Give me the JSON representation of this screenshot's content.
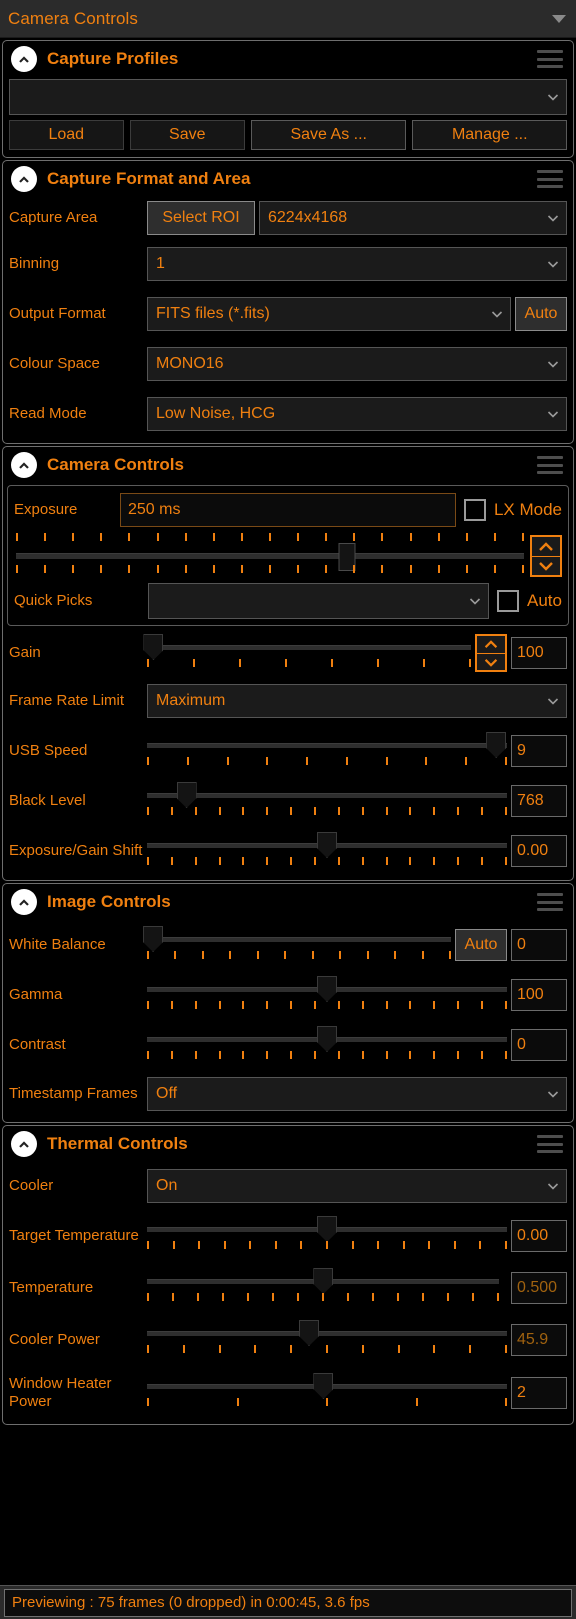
{
  "window": {
    "title": "Camera Controls",
    "caret_icon": "caret-down-icon"
  },
  "sections": {
    "capture_profiles": {
      "title": "Capture Profiles",
      "profile_value": "",
      "buttons": {
        "load": "Load",
        "save": "Save",
        "save_as": "Save As ...",
        "manage": "Manage ..."
      }
    },
    "capture_format": {
      "title": "Capture Format and Area",
      "capture_area": {
        "label": "Capture Area",
        "select_roi": "Select ROI",
        "value": "6224x4168"
      },
      "binning": {
        "label": "Binning",
        "value": "1"
      },
      "output_format": {
        "label": "Output Format",
        "value": "FITS files (*.fits)",
        "auto": "Auto"
      },
      "colour_space": {
        "label": "Colour Space",
        "value": "MONO16"
      },
      "read_mode": {
        "label": "Read Mode",
        "value": "Low Noise, HCG"
      }
    },
    "camera_controls": {
      "title": "Camera Controls",
      "exposure": {
        "label": "Exposure",
        "value": "250 ms",
        "lx_mode_label": "LX Mode",
        "lx_mode_checked": false,
        "slider_percent": 65
      },
      "quick_picks": {
        "label": "Quick Picks",
        "value": "",
        "auto_label": "Auto",
        "auto_checked": false
      },
      "gain": {
        "label": "Gain",
        "value": "100",
        "slider_percent": 2
      },
      "frame_rate_limit": {
        "label": "Frame Rate Limit",
        "value": "Maximum"
      },
      "usb_speed": {
        "label": "USB Speed",
        "value": "9",
        "slider_percent": 97
      },
      "black_level": {
        "label": "Black Level",
        "value": "768",
        "slider_percent": 11
      },
      "exposure_gain_shift": {
        "label": "Exposure/Gain Shift",
        "value": "0.00",
        "slider_percent": 50
      }
    },
    "image_controls": {
      "title": "Image Controls",
      "white_balance": {
        "label": "White Balance",
        "value": "0",
        "auto": "Auto",
        "slider_percent": 2
      },
      "gamma": {
        "label": "Gamma",
        "value": "100",
        "slider_percent": 50
      },
      "contrast": {
        "label": "Contrast",
        "value": "0",
        "slider_percent": 50
      },
      "timestamp_frames": {
        "label": "Timestamp Frames",
        "value": "Off"
      }
    },
    "thermal_controls": {
      "title": "Thermal Controls",
      "cooler": {
        "label": "Cooler",
        "value": "On"
      },
      "target_temperature": {
        "label": "Target Temperature",
        "value": "0.00",
        "slider_percent": 50
      },
      "temperature": {
        "label": "Temperature",
        "value": "0.500",
        "slider_percent": 49
      },
      "cooler_power": {
        "label": "Cooler Power",
        "value": "45.9",
        "slider_percent": 45
      },
      "window_heater_power": {
        "label": "Window Heater Power",
        "value": "2",
        "slider_percent": 49
      }
    }
  },
  "statusbar": {
    "text": "Previewing : 75 frames (0 dropped) in 0:00:45, 3.6 fps"
  },
  "colors": {
    "accent": "#f08010",
    "background": "#000000",
    "panel": "#2b2b2b",
    "border": "#6e6e6e"
  }
}
